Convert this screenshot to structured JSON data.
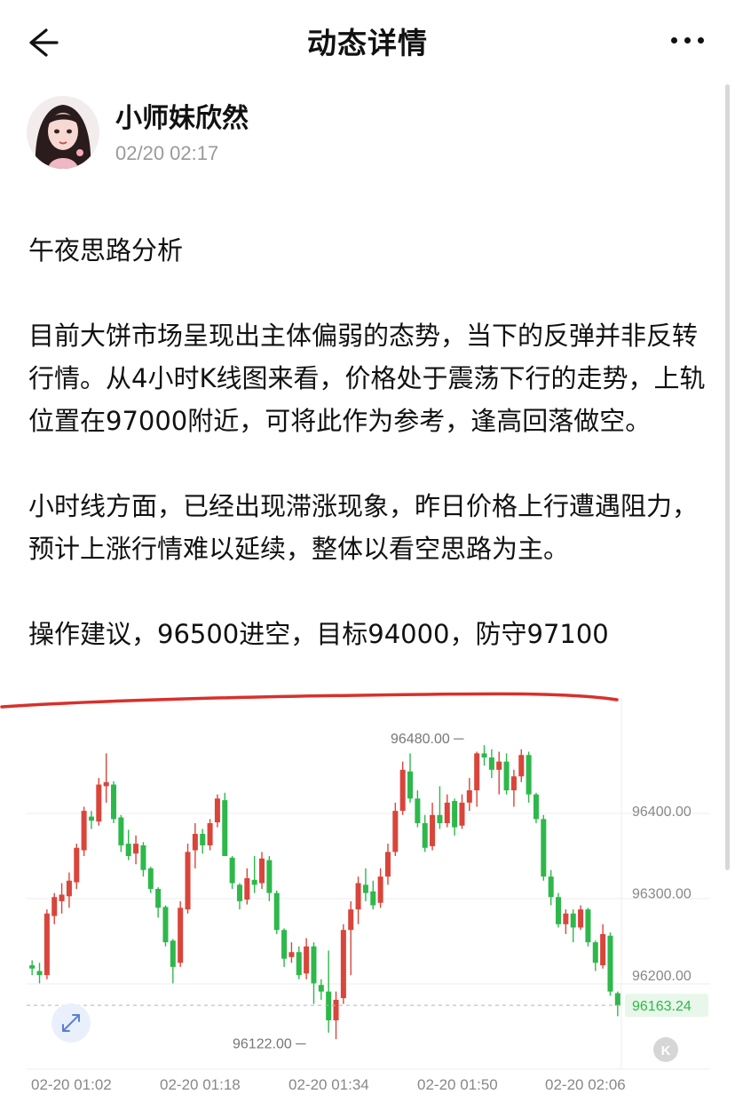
{
  "header": {
    "title": "动态详情",
    "back_icon": "back-arrow-icon",
    "more_icon": "more-dots-icon"
  },
  "post": {
    "author": "小师妹欣然",
    "timestamp": "02/20 02:17",
    "paragraphs": [
      "午夜思路分析",
      "目前大饼市场呈现出主体偏弱的态势，当下的反弹并非反转行情。从4小时K线图来看，价格处于震荡下行的走势，上轨位置在97000附近，可将此作为参考，逢高回落做空。",
      "小时线方面，已经出现滞涨现象，昨日价格上行遭遇阻力，预计上涨行情难以延续，整体以看空思路为主。",
      "操作建议，96500进空，目标94000，防守97100"
    ]
  },
  "colors": {
    "up": "#d9453b",
    "down": "#2eb84b",
    "annotation_underline": "#d9302b",
    "current_price_bg": "#e8f7ea"
  },
  "chart_data": {
    "type": "candlestick",
    "x_tick_labels": [
      "02-20 01:02",
      "02-20 01:18",
      "02-20 01:34",
      "02-20 01:50",
      "02-20 02:06"
    ],
    "y_tick_labels": [
      "96400.00",
      "96300.00",
      "96200.00"
    ],
    "ylim": [
      96105,
      96505
    ],
    "high_label": "96480.00",
    "low_label": "96122.00",
    "current_price": "96163.24",
    "candles": [
      {
        "o": 96212,
        "h": 96218,
        "l": 96200,
        "c": 96208
      },
      {
        "o": 96205,
        "h": 96215,
        "l": 96190,
        "c": 96200
      },
      {
        "o": 96200,
        "h": 96280,
        "l": 96195,
        "c": 96275
      },
      {
        "o": 96272,
        "h": 96300,
        "l": 96262,
        "c": 96295
      },
      {
        "o": 96290,
        "h": 96312,
        "l": 96275,
        "c": 96298
      },
      {
        "o": 96296,
        "h": 96325,
        "l": 96282,
        "c": 96315
      },
      {
        "o": 96313,
        "h": 96360,
        "l": 96305,
        "c": 96355
      },
      {
        "o": 96352,
        "h": 96405,
        "l": 96345,
        "c": 96400
      },
      {
        "o": 96393,
        "h": 96400,
        "l": 96378,
        "c": 96388
      },
      {
        "o": 96387,
        "h": 96440,
        "l": 96382,
        "c": 96432
      },
      {
        "o": 96430,
        "h": 96470,
        "l": 96410,
        "c": 96435
      },
      {
        "o": 96432,
        "h": 96436,
        "l": 96385,
        "c": 96390
      },
      {
        "o": 96392,
        "h": 96395,
        "l": 96350,
        "c": 96358
      },
      {
        "o": 96360,
        "h": 96377,
        "l": 96340,
        "c": 96345
      },
      {
        "o": 96348,
        "h": 96370,
        "l": 96335,
        "c": 96360
      },
      {
        "o": 96358,
        "h": 96362,
        "l": 96320,
        "c": 96328
      },
      {
        "o": 96330,
        "h": 96332,
        "l": 96300,
        "c": 96305
      },
      {
        "o": 96305,
        "h": 96307,
        "l": 96270,
        "c": 96282
      },
      {
        "o": 96283,
        "h": 96285,
        "l": 96235,
        "c": 96240
      },
      {
        "o": 96242,
        "h": 96244,
        "l": 96190,
        "c": 96210
      },
      {
        "o": 96215,
        "h": 96290,
        "l": 96210,
        "c": 96282
      },
      {
        "o": 96280,
        "h": 96360,
        "l": 96275,
        "c": 96350
      },
      {
        "o": 96352,
        "h": 96385,
        "l": 96330,
        "c": 96372
      },
      {
        "o": 96372,
        "h": 96378,
        "l": 96348,
        "c": 96358
      },
      {
        "o": 96358,
        "h": 96390,
        "l": 96352,
        "c": 96385
      },
      {
        "o": 96386,
        "h": 96420,
        "l": 96380,
        "c": 96415
      },
      {
        "o": 96413,
        "h": 96422,
        "l": 96345,
        "c": 96345
      },
      {
        "o": 96343,
        "h": 96345,
        "l": 96305,
        "c": 96312
      },
      {
        "o": 96310,
        "h": 96312,
        "l": 96280,
        "c": 96290
      },
      {
        "o": 96292,
        "h": 96330,
        "l": 96286,
        "c": 96318
      },
      {
        "o": 96316,
        "h": 96345,
        "l": 96300,
        "c": 96310
      },
      {
        "o": 96312,
        "h": 96350,
        "l": 96305,
        "c": 96342
      },
      {
        "o": 96340,
        "h": 96345,
        "l": 96290,
        "c": 96300
      },
      {
        "o": 96300,
        "h": 96303,
        "l": 96250,
        "c": 96255
      },
      {
        "o": 96255,
        "h": 96257,
        "l": 96210,
        "c": 96220
      },
      {
        "o": 96222,
        "h": 96240,
        "l": 96215,
        "c": 96228
      },
      {
        "o": 96228,
        "h": 96235,
        "l": 96195,
        "c": 96200
      },
      {
        "o": 96202,
        "h": 96245,
        "l": 96195,
        "c": 96235
      },
      {
        "o": 96235,
        "h": 96240,
        "l": 96165,
        "c": 96190
      },
      {
        "o": 96188,
        "h": 96195,
        "l": 96170,
        "c": 96180
      },
      {
        "o": 96180,
        "h": 96230,
        "l": 96130,
        "c": 96145
      },
      {
        "o": 96145,
        "h": 96180,
        "l": 96122,
        "c": 96170
      },
      {
        "o": 96172,
        "h": 96262,
        "l": 96165,
        "c": 96255
      },
      {
        "o": 96255,
        "h": 96290,
        "l": 96200,
        "c": 96280
      },
      {
        "o": 96280,
        "h": 96320,
        "l": 96262,
        "c": 96312
      },
      {
        "o": 96310,
        "h": 96330,
        "l": 96290,
        "c": 96300
      },
      {
        "o": 96302,
        "h": 96315,
        "l": 96280,
        "c": 96285
      },
      {
        "o": 96288,
        "h": 96330,
        "l": 96282,
        "c": 96320
      },
      {
        "o": 96320,
        "h": 96360,
        "l": 96310,
        "c": 96350
      },
      {
        "o": 96350,
        "h": 96410,
        "l": 96345,
        "c": 96400
      },
      {
        "o": 96400,
        "h": 96460,
        "l": 96395,
        "c": 96450
      },
      {
        "o": 96448,
        "h": 96470,
        "l": 96410,
        "c": 96415
      },
      {
        "o": 96415,
        "h": 96425,
        "l": 96380,
        "c": 96385
      },
      {
        "o": 96385,
        "h": 96395,
        "l": 96350,
        "c": 96355
      },
      {
        "o": 96357,
        "h": 96410,
        "l": 96352,
        "c": 96395
      },
      {
        "o": 96395,
        "h": 96430,
        "l": 96378,
        "c": 96385
      },
      {
        "o": 96385,
        "h": 96420,
        "l": 96380,
        "c": 96410
      },
      {
        "o": 96412,
        "h": 96415,
        "l": 96370,
        "c": 96380
      },
      {
        "o": 96382,
        "h": 96420,
        "l": 96378,
        "c": 96410
      },
      {
        "o": 96410,
        "h": 96440,
        "l": 96400,
        "c": 96425
      },
      {
        "o": 96425,
        "h": 96472,
        "l": 96405,
        "c": 96470
      },
      {
        "o": 96470,
        "h": 96480,
        "l": 96455,
        "c": 96465
      },
      {
        "o": 96465,
        "h": 96475,
        "l": 96440,
        "c": 96450
      },
      {
        "o": 96450,
        "h": 96472,
        "l": 96420,
        "c": 96460
      },
      {
        "o": 96460,
        "h": 96470,
        "l": 96420,
        "c": 96425
      },
      {
        "o": 96425,
        "h": 96450,
        "l": 96405,
        "c": 96442
      },
      {
        "o": 96442,
        "h": 96475,
        "l": 96435,
        "c": 96468
      },
      {
        "o": 96468,
        "h": 96472,
        "l": 96410,
        "c": 96420
      },
      {
        "o": 96420,
        "h": 96422,
        "l": 96385,
        "c": 96390
      },
      {
        "o": 96390,
        "h": 96395,
        "l": 96315,
        "c": 96320
      },
      {
        "o": 96320,
        "h": 96328,
        "l": 96285,
        "c": 96295
      },
      {
        "o": 96295,
        "h": 96300,
        "l": 96258,
        "c": 96262
      },
      {
        "o": 96262,
        "h": 96280,
        "l": 96250,
        "c": 96275
      },
      {
        "o": 96275,
        "h": 96280,
        "l": 96240,
        "c": 96258
      },
      {
        "o": 96258,
        "h": 96285,
        "l": 96255,
        "c": 96280
      },
      {
        "o": 96280,
        "h": 96282,
        "l": 96235,
        "c": 96240
      },
      {
        "o": 96240,
        "h": 96242,
        "l": 96205,
        "c": 96215
      },
      {
        "o": 96212,
        "h": 96262,
        "l": 96208,
        "c": 96250
      },
      {
        "o": 96248,
        "h": 96252,
        "l": 96175,
        "c": 96180
      },
      {
        "o": 96178,
        "h": 96180,
        "l": 96150,
        "c": 96163
      }
    ]
  }
}
